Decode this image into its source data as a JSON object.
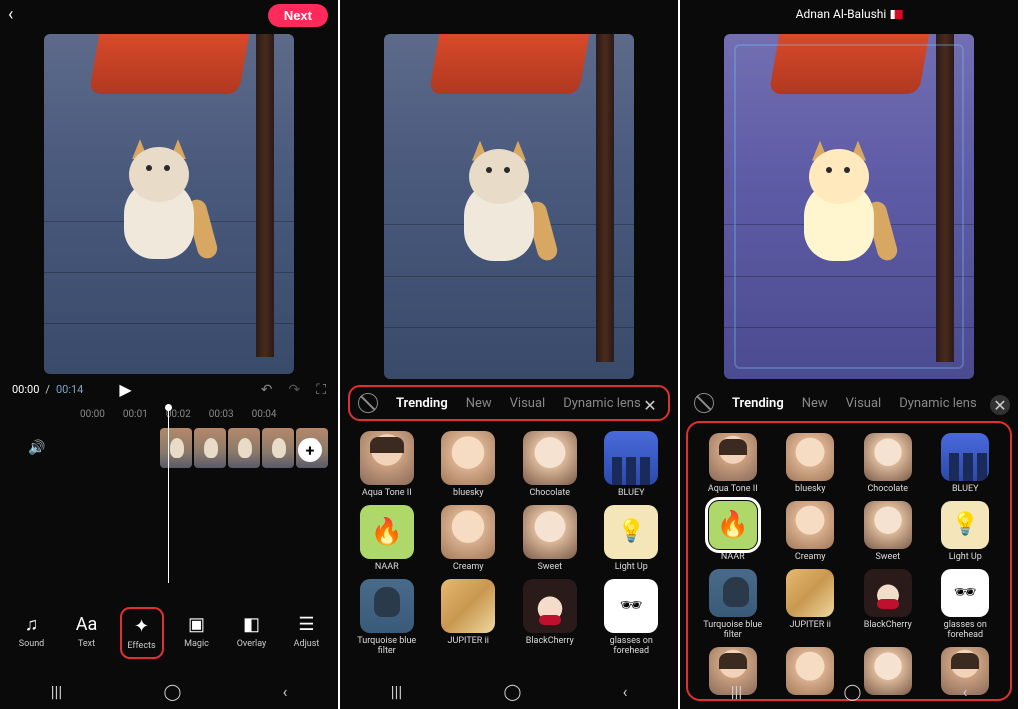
{
  "panel1": {
    "next_label": "Next",
    "time_current": "00:00",
    "time_sep": "/",
    "time_duration": "00:14",
    "ticks": [
      "00:00",
      "00:01",
      "00:02",
      "00:03",
      "00:04"
    ],
    "tools": [
      {
        "icon": "♫",
        "label": "Sound"
      },
      {
        "icon": "Aa",
        "label": "Text"
      },
      {
        "icon": "✦",
        "label": "Effects"
      },
      {
        "icon": "▣",
        "label": "Magic"
      },
      {
        "icon": "◧",
        "label": "Overlay"
      },
      {
        "icon": "☰",
        "label": "Adjust"
      }
    ],
    "highlight_tool_index": 2
  },
  "panel2": {
    "tabs": [
      "Trending",
      "New",
      "Visual",
      "Dynamic lens"
    ],
    "active_tab": 0,
    "effects": [
      {
        "label": "Aqua Tone II",
        "thumb": "th-face"
      },
      {
        "label": "bluesky",
        "thumb": "th-face2"
      },
      {
        "label": "Chocolate",
        "thumb": "th-face3"
      },
      {
        "label": "BLUEY",
        "thumb": "th-city"
      },
      {
        "label": "NAAR",
        "thumb": "th-fire",
        "emoji": "🔥"
      },
      {
        "label": "Creamy",
        "thumb": "th-face2"
      },
      {
        "label": "Sweet",
        "thumb": "th-face3"
      },
      {
        "label": "Light Up",
        "thumb": "th-bulb",
        "emoji": "💡"
      },
      {
        "label": "Turquoise blue filter",
        "thumb": "th-turq"
      },
      {
        "label": "JUPITER ii",
        "thumb": "th-jup"
      },
      {
        "label": "BlackCherry",
        "thumb": "th-cherry"
      },
      {
        "label": "glasses on forehead",
        "thumb": "th-glasses",
        "emoji": "🕶"
      }
    ]
  },
  "panel3": {
    "user": "Adnan Al-Balushi",
    "tabs": [
      "Trending",
      "New",
      "Visual",
      "Dynamic lens"
    ],
    "active_tab": 0,
    "selected_effect": "NAAR",
    "effects": [
      {
        "label": "Aqua Tone II",
        "thumb": "th-face"
      },
      {
        "label": "bluesky",
        "thumb": "th-face2"
      },
      {
        "label": "Chocolate",
        "thumb": "th-face3"
      },
      {
        "label": "BLUEY",
        "thumb": "th-city"
      },
      {
        "label": "NAAR",
        "thumb": "th-fire",
        "emoji": "🔥"
      },
      {
        "label": "Creamy",
        "thumb": "th-face2"
      },
      {
        "label": "Sweet",
        "thumb": "th-face3"
      },
      {
        "label": "Light Up",
        "thumb": "th-bulb",
        "emoji": "💡"
      },
      {
        "label": "Turquoise blue filter",
        "thumb": "th-turq"
      },
      {
        "label": "JUPITER ii",
        "thumb": "th-jup"
      },
      {
        "label": "BlackCherry",
        "thumb": "th-cherry"
      },
      {
        "label": "glasses on forehead",
        "thumb": "th-glasses",
        "emoji": "🕶"
      }
    ],
    "extra_row": [
      {
        "thumb": "th-face"
      },
      {
        "thumb": "th-face2"
      },
      {
        "thumb": "th-face3"
      },
      {
        "thumb": "th-face"
      }
    ]
  }
}
